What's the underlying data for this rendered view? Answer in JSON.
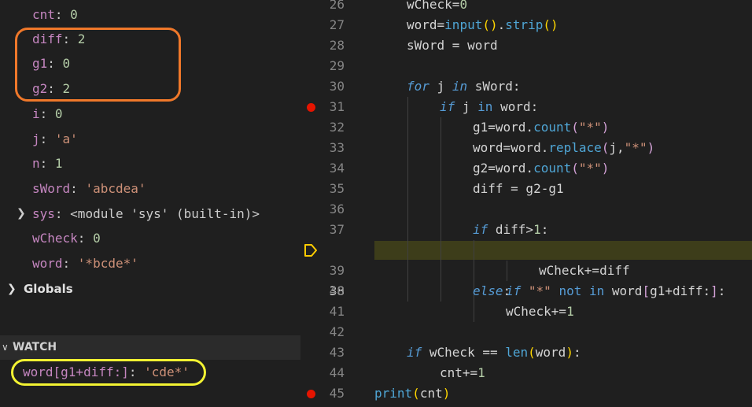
{
  "variables": {
    "locals": [
      {
        "name": "cnt",
        "value": "0",
        "type": "num"
      },
      {
        "name": "diff",
        "value": "2",
        "type": "num"
      },
      {
        "name": "g1",
        "value": "0",
        "type": "num"
      },
      {
        "name": "g2",
        "value": "2",
        "type": "num"
      },
      {
        "name": "i",
        "value": "0",
        "type": "num"
      },
      {
        "name": "j",
        "value": "'a'",
        "type": "str"
      },
      {
        "name": "n",
        "value": "1",
        "type": "num"
      },
      {
        "name": "sWord",
        "value": "'abcdea'",
        "type": "str"
      },
      {
        "name": "sys",
        "value": "<module 'sys' (built-in)>",
        "type": "obj"
      },
      {
        "name": "wCheck",
        "value": "0",
        "type": "num"
      },
      {
        "name": "word",
        "value": "'*bcde*'",
        "type": "str"
      }
    ],
    "globals_label": "Globals"
  },
  "watch": {
    "header": "WATCH",
    "expression": "word[g1+diff:]",
    "value": "'cde*'"
  },
  "editor": {
    "current_line": "38",
    "breakpoints": [
      "31",
      "45"
    ],
    "lines": [
      {
        "n": "26",
        "text": "wCheck=0"
      },
      {
        "n": "27",
        "text": "word=input().strip()"
      },
      {
        "n": "28",
        "text": "sWord = word"
      },
      {
        "n": "29",
        "text": ""
      },
      {
        "n": "30",
        "text": "for j in sWord:"
      },
      {
        "n": "31",
        "text": "if j in word:"
      },
      {
        "n": "32",
        "text": "g1=word.count(\"*\")"
      },
      {
        "n": "33",
        "text": "word=word.replace(j,\"*\")"
      },
      {
        "n": "34",
        "text": "g2=word.count(\"*\")"
      },
      {
        "n": "35",
        "text": "diff = g2-g1"
      },
      {
        "n": "36",
        "text": ""
      },
      {
        "n": "37",
        "text": "if diff>1:"
      },
      {
        "n": "38",
        "text": "if \"*\" not in word[g1+diff:]:"
      },
      {
        "n": "39",
        "text": "wCheck+=diff"
      },
      {
        "n": "40",
        "text": "else:"
      },
      {
        "n": "41",
        "text": "wCheck+=1"
      },
      {
        "n": "42",
        "text": ""
      },
      {
        "n": "43",
        "text": "if wCheck == len(word):"
      },
      {
        "n": "44",
        "text": "cnt+=1"
      },
      {
        "n": "45",
        "text": "print(cnt)"
      }
    ]
  },
  "colors": {
    "highlight_box": "#f0782a",
    "watch_box": "#f2f232",
    "breakpoint": "#e51400",
    "current_line_bg": "#3d3d1a"
  }
}
